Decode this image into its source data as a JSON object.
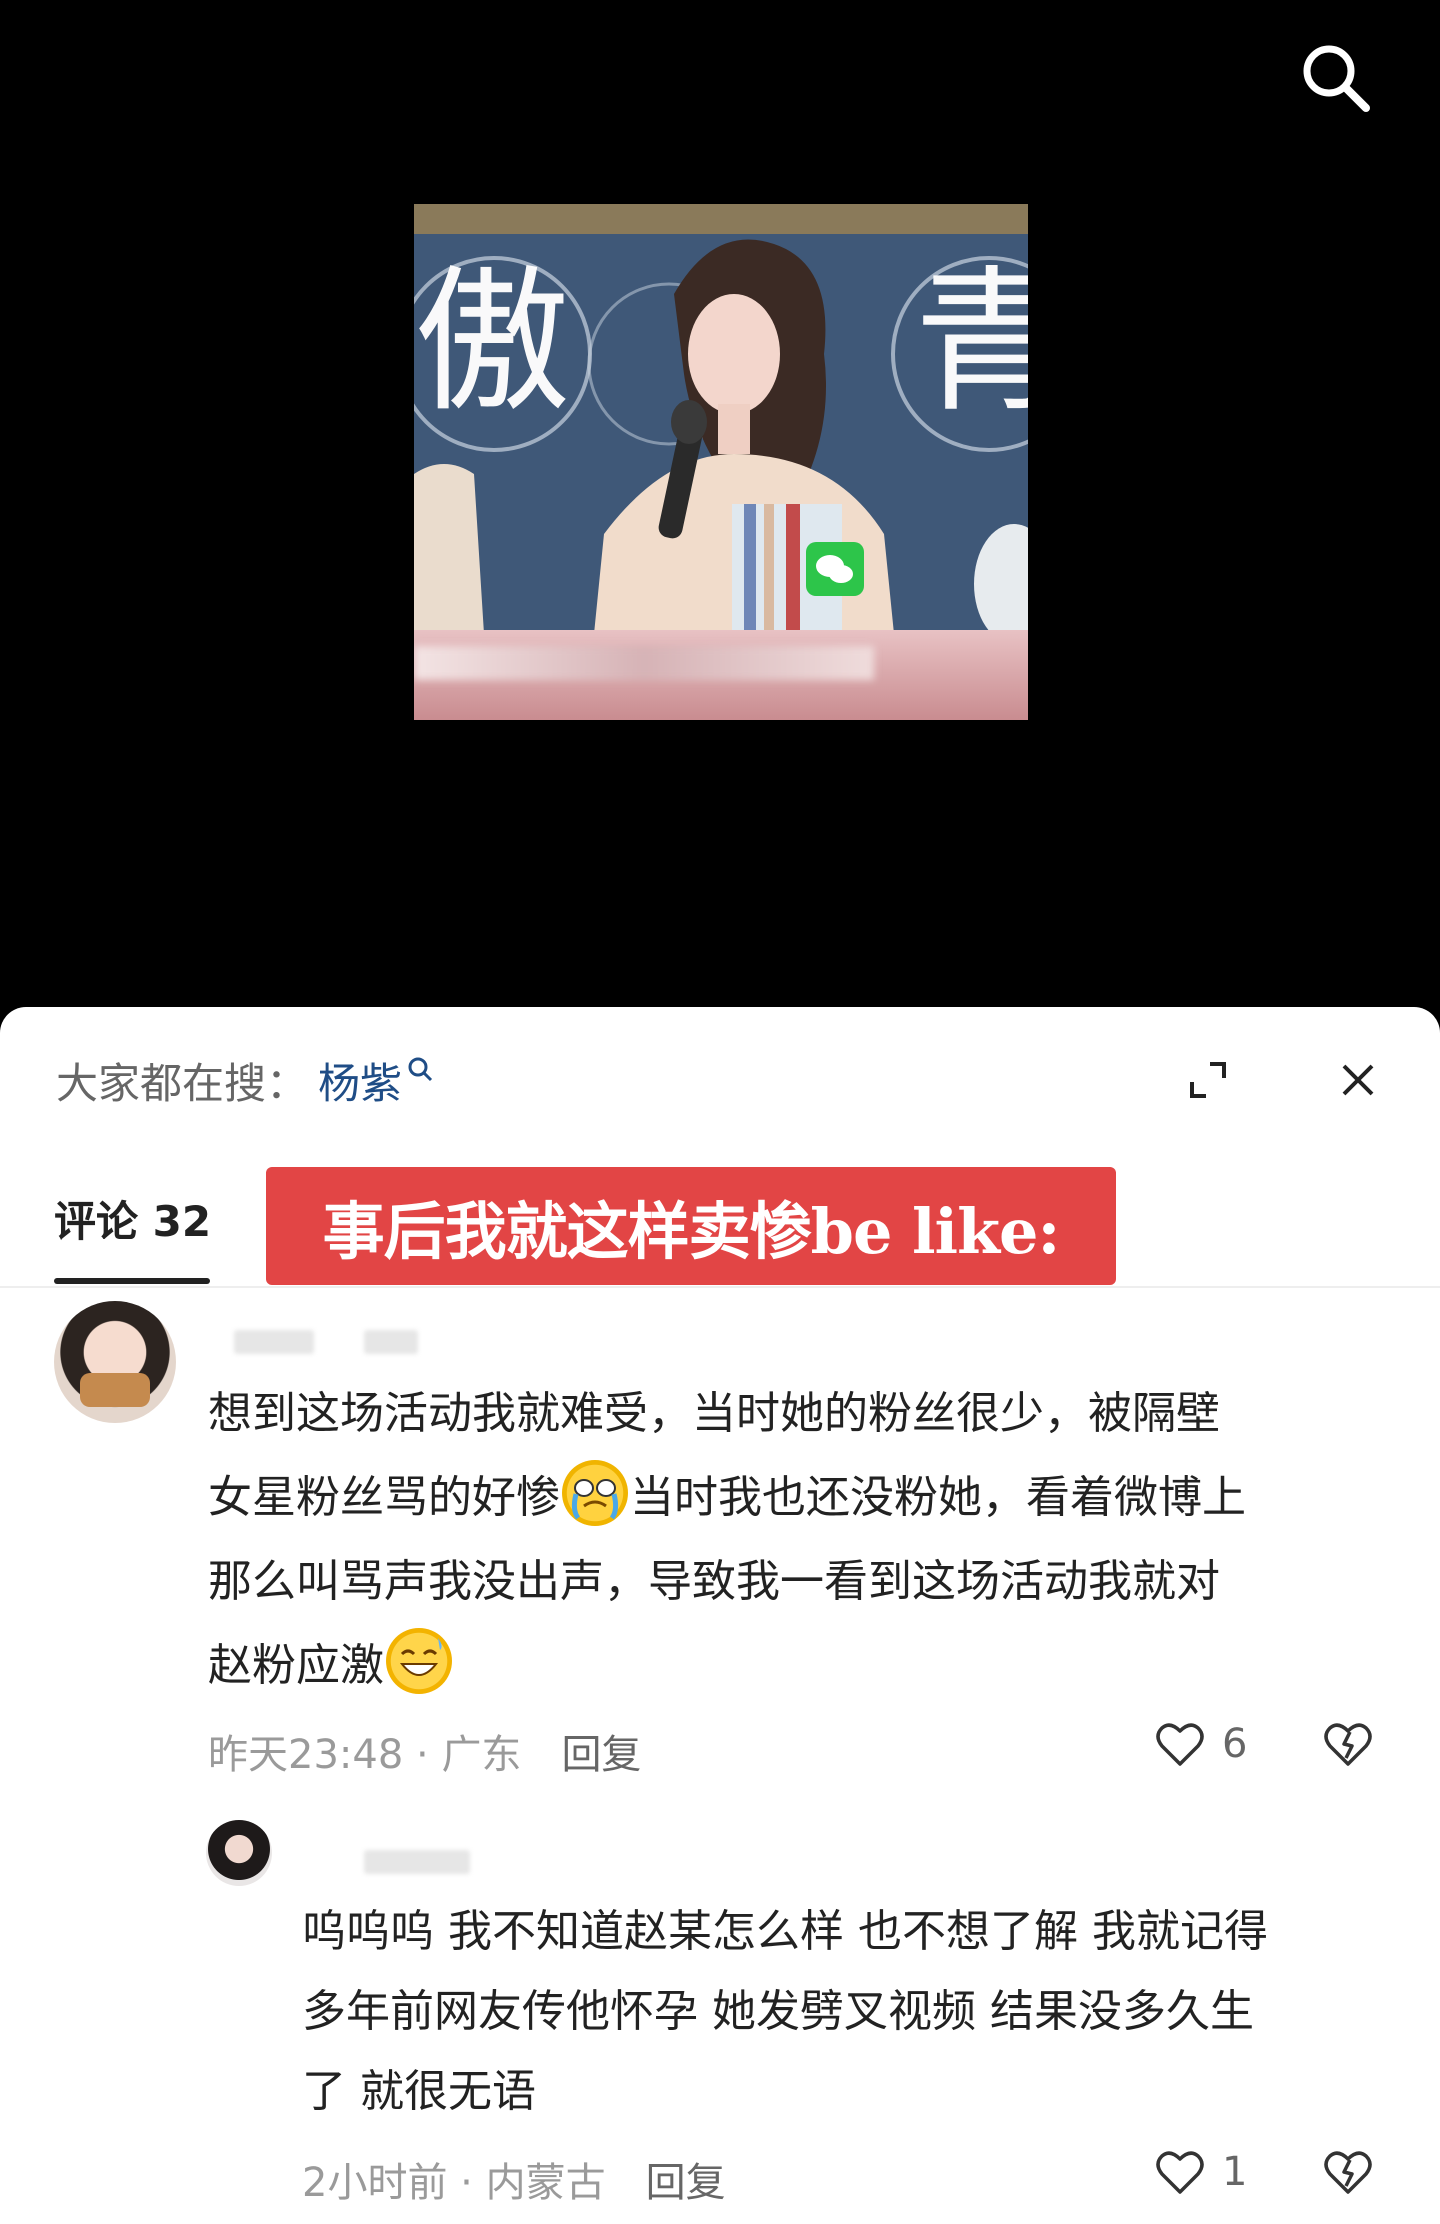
{
  "video": {
    "title_chars": [
      "傲",
      "青"
    ],
    "search_icon": "search-icon"
  },
  "comment_panel": {
    "hot_search_prefix": "大家都在搜：",
    "hot_search_keyword": "杨紫",
    "tab_label": "评论 32",
    "caption_banner": "事后我就这样卖惨be like:",
    "colors": {
      "banner": "#e24545",
      "keyword": "#1f4d86"
    }
  },
  "comments": [
    {
      "text_before_emoji": "想到这场活动我就难受，当时她的粉丝很少，被隔壁\n女星粉丝骂的好惨",
      "emoji_1": "crying-face-icon",
      "text_middle": "当时我也还没粉她，看着微博上\n那么叫骂声我没出声，导致我一看到这场活动我就对\n赵粉应激",
      "emoji_2": "grinning-sweat-face-icon",
      "time": "昨天23:48",
      "location": "广东",
      "reply_label": "回复",
      "likes": "6"
    },
    {
      "text": "呜呜呜 我不知道赵某怎么样 也不想了解 我就记得\n多年前网友传他怀孕 她发劈叉视频 结果没多久生\n了 就很无语",
      "time": "2小时前",
      "location": "内蒙古",
      "reply_label": "回复",
      "likes": "1"
    }
  ]
}
